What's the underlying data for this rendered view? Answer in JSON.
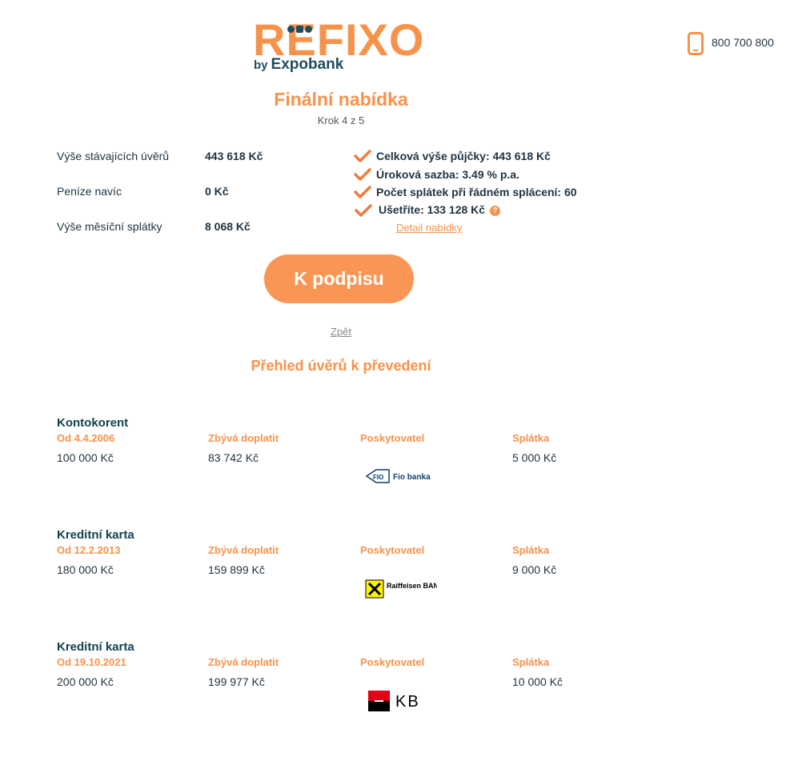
{
  "brand": {
    "name": "REFIXO",
    "by": "by",
    "parent": "Expobank"
  },
  "contact": {
    "icon": "phone-icon",
    "phone": "800 700 800"
  },
  "header": {
    "title": "Finální nabídka",
    "step": "Krok 4 z 5"
  },
  "summary": {
    "rows": [
      {
        "label": "Výše stávajících úvěrů",
        "value": "443 618 Kč"
      },
      {
        "label": "Peníze navíc",
        "value": "0 Kč"
      },
      {
        "label": "Výše měsíční splátky",
        "value": "8 068 Kč"
      }
    ],
    "benefits": [
      "Celková výše půjčky: 443 618 Kč",
      "Úroková sazba: 3.49 % p.a.",
      "Počet splátek při řádném splácení: 60",
      "Ušetříte: 133 128 Kč"
    ],
    "help_icon": "?",
    "detail_link": "Detail nabídky"
  },
  "actions": {
    "submit": "K podpisu",
    "back": "Zpět"
  },
  "loans_section": {
    "title": "Přehled úvěrů k převedení",
    "columns": {
      "remaining": "Zbývá doplatit",
      "provider": "Poskytovatel",
      "installment": "Splátka"
    },
    "loans": [
      {
        "type": "Kontokorent",
        "since": "Od 4.4.2006",
        "amount": "100 000 Kč",
        "remaining": "83 742 Kč",
        "provider": "Fio banka",
        "installment": "5 000 Kč"
      },
      {
        "type": "Kreditní karta",
        "since": "Od 12.2.2013",
        "amount": "180 000 Kč",
        "remaining": "159 899 Kč",
        "provider": "Raiffeisen BANK",
        "installment": "9 000 Kč"
      },
      {
        "type": "Kreditní karta",
        "since": "Od 19.10.2021",
        "amount": "200 000 Kč",
        "remaining": "199 977 Kč",
        "provider": "KB",
        "installment": "10 000 Kč"
      }
    ]
  },
  "colors": {
    "accent": "#f7924a",
    "button": "#f99655",
    "dark": "#1f3340",
    "teal": "#1f4d5c"
  }
}
